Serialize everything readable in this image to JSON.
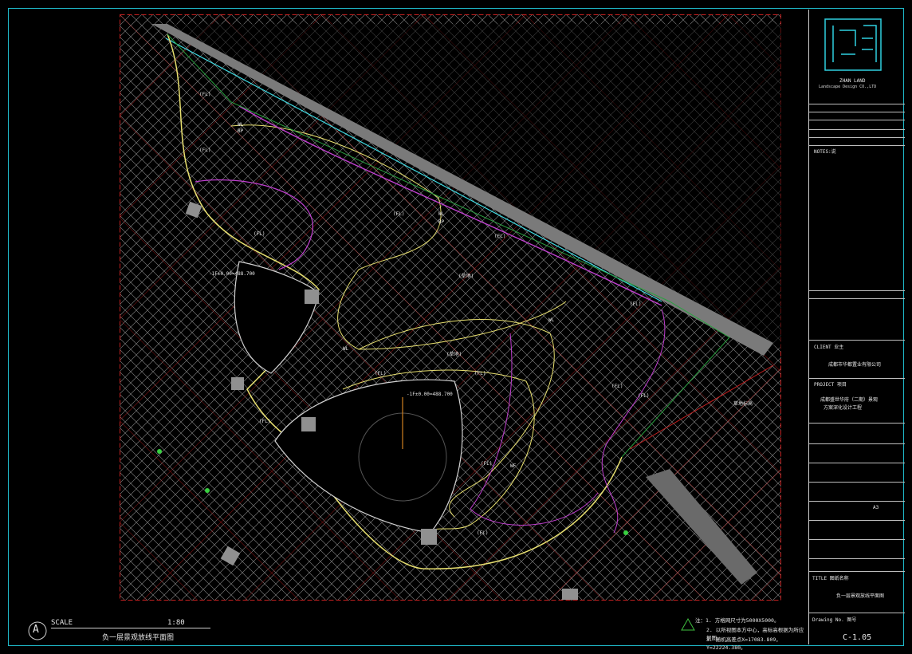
{
  "drawing": {
    "company_name": "ZHAN LAND",
    "company_subtitle": "Landscape Design CO.,LTD",
    "notes_title": "NOTES:说",
    "client_label": "CLIENT 业主",
    "client_value": "成都市华都置业有限公司",
    "project_label": "PROJECT 项目",
    "project_value_1": "成都盛世华府（二期）景观",
    "project_value_2": "方案深化设计工程",
    "sheet_size": "A3",
    "drawing_title_label": "TITLE 图纸名称",
    "drawing_title_value": "负一层景观放线平面图",
    "drawing_no_label": "Drawing No. 图号",
    "drawing_no_value": "C-1.05",
    "scale_letter": "A",
    "scale_label": "SCALE",
    "scale_value": "1:80",
    "plan_title": "负一层景观放线平面图",
    "notes": [
      "注：1. 方格网尺寸为5000X5000。",
      "2. 以所视图本方中心，高标高根据为所应据图。",
      "3. 随机高差点X=17083.809，Y=22224.380。"
    ],
    "plan_labels": {
      "fl": "(FL)",
      "wl": "WL",
      "bp": "BP",
      "wf": "WF",
      "lawn": "(草地)",
      "elev_1": "-1F±0.00=488.700",
      "elev_2": "-1F±0.00=488.700",
      "legend_note": "草地标高"
    }
  }
}
